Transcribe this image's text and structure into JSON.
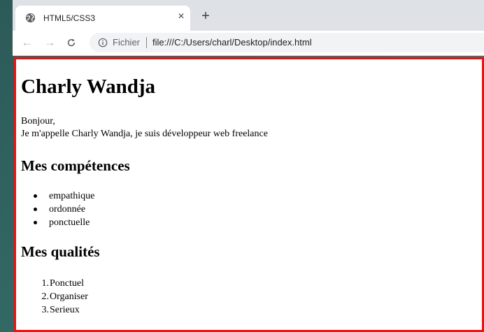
{
  "browser": {
    "tab": {
      "title": "HTML5/CSS3",
      "favicon": "globe-icon",
      "close_glyph": "×"
    },
    "new_tab_glyph": "+",
    "toolbar": {
      "back_glyph": "←",
      "forward_glyph": "→",
      "reload_glyph": "C",
      "security_icon": "info-icon",
      "scheme_label": "Fichier",
      "url": "file:///C:/Users/charl/Desktop/index.html"
    }
  },
  "page": {
    "title": "Charly Wandja",
    "intro": [
      "Bonjour,",
      "Je m'appelle Charly Wandja, je suis développeur web freelance"
    ],
    "skills_heading": "Mes compétences",
    "skills": [
      "empathique",
      "ordonnée",
      "ponctuelle"
    ],
    "qualities_heading": "Mes qualités",
    "qualities": [
      {
        "number": "1.",
        "text": "Ponctuel"
      },
      {
        "number": "2.",
        "text": "Organiser"
      },
      {
        "number": "3.",
        "text": "Serieux"
      }
    ]
  },
  "colors": {
    "highlight_border": "#ee1111",
    "tabstrip": "#dee1e6",
    "omnibox": "#f1f3f4",
    "background": "#336a66"
  }
}
